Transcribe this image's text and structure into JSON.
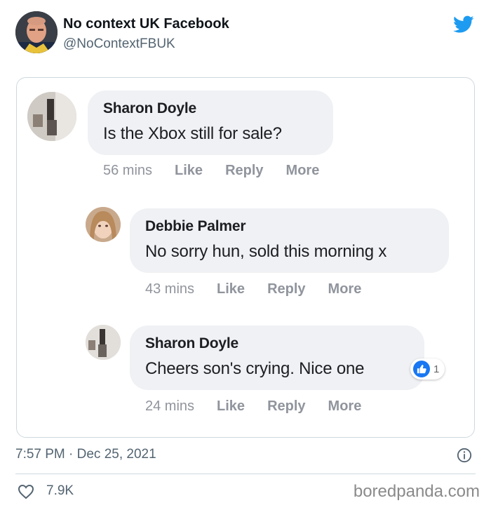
{
  "tweet": {
    "author_name": "No context UK Facebook",
    "author_handle": "@NoContextFBUK",
    "timestamp": "7:57 PM · Dec 25, 2021",
    "likes": "7.9K",
    "watermark": "boredpanda.com",
    "brand_color": "#1d9bf0"
  },
  "comments": [
    {
      "name": "Sharon Doyle",
      "text": "Is the Xbox still for sale?",
      "time": "56 mins",
      "like": "Like",
      "reply": "Reply",
      "more": "More"
    },
    {
      "name": "Debbie Palmer",
      "text": "No sorry hun, sold this morning x",
      "time": "43 mins",
      "like": "Like",
      "reply": "Reply",
      "more": "More"
    },
    {
      "name": "Sharon Doyle",
      "text": "Cheers son's crying. Nice one",
      "time": "24 mins",
      "like": "Like",
      "reply": "Reply",
      "more": "More",
      "reaction_count": "1"
    }
  ],
  "icons": {
    "twitter": "twitter-bird-icon",
    "info": "info-icon",
    "heart": "heart-icon",
    "like_reaction": "thumbs-up-icon"
  }
}
